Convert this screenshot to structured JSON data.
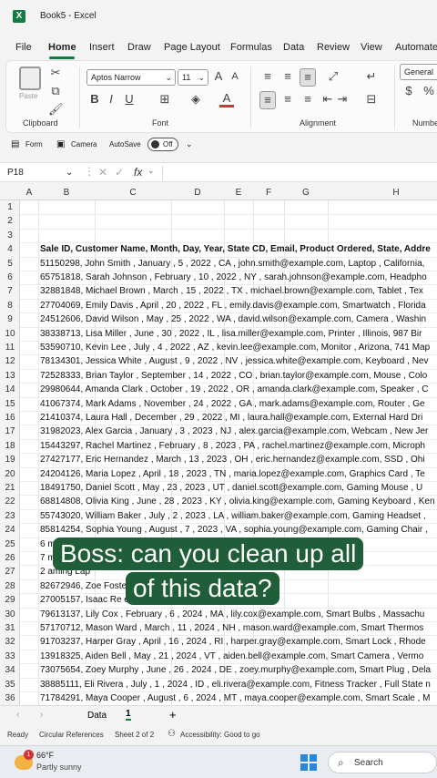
{
  "titlebar": {
    "app_icon": "X",
    "title": "Book5 - Excel"
  },
  "menu_tabs": [
    "File",
    "Home",
    "Insert",
    "Draw",
    "Page Layout",
    "Formulas",
    "Data",
    "Review",
    "View",
    "Automate"
  ],
  "ribbon": {
    "clipboard": {
      "paste_label": "Paste",
      "group_label": "Clipboard"
    },
    "font": {
      "font_name": "Aptos Narrow",
      "font_size": "11",
      "group_label": "Font"
    },
    "alignment": {
      "group_label": "Alignment"
    },
    "number": {
      "format": "General",
      "group_label": "Numbe"
    }
  },
  "quickbar": {
    "form_label": "Form",
    "camera_label": "Camera",
    "autosave_label": "AutoSave",
    "autosave_state": "Off"
  },
  "formula_bar": {
    "name_box": "P18",
    "fx": "fx"
  },
  "columns": [
    "A",
    "B",
    "C",
    "D",
    "E",
    "F",
    "G",
    "H"
  ],
  "rows": [
    {
      "n": "1",
      "text": ""
    },
    {
      "n": "2",
      "text": ""
    },
    {
      "n": "3",
      "text": ""
    },
    {
      "n": "4",
      "text": "Sale ID, Customer Name, Month, Day, Year, State CD, Email, Product Ordered, State, Addre",
      "bold": true
    },
    {
      "n": "5",
      "text": "51150298, John Smith , January , 5 , 2022 , CA , john.smith@example.com, Laptop , California,"
    },
    {
      "n": "6",
      "text": "65751818, Sarah Johnson , February , 10 , 2022 , NY , sarah.johnson@example.com, Headpho"
    },
    {
      "n": "7",
      "text": "32881848, Michael Brown , March , 15 , 2022 , TX , michael.brown@example.com, Tablet , Tex"
    },
    {
      "n": "8",
      "text": "27704069, Emily Davis , April , 20 , 2022 , FL , emily.davis@example.com, Smartwatch , Florida"
    },
    {
      "n": "9",
      "text": "24512606, David Wilson , May , 25 , 2022 , WA , david.wilson@example.com, Camera , Washin"
    },
    {
      "n": "10",
      "text": "38338713, Lisa Miller , June , 30 , 2022 , IL , lisa.miller@example.com, Printer , Illinois, 987 Bir"
    },
    {
      "n": "11",
      "text": "53590710, Kevin Lee , July , 4 , 2022 , AZ , kevin.lee@example.com, Monitor , Arizona, 741 Map"
    },
    {
      "n": "12",
      "text": "78134301, Jessica White , August , 9 , 2022 , NV , jessica.white@example.com, Keyboard , Nev"
    },
    {
      "n": "13",
      "text": "72528333, Brian Taylor , September , 14 , 2022 , CO , brian.taylor@example.com, Mouse , Colo"
    },
    {
      "n": "14",
      "text": "29980644, Amanda Clark , October , 19 , 2022 , OR , amanda.clark@example.com, Speaker , C"
    },
    {
      "n": "15",
      "text": "41067374, Mark Adams , November , 24 , 2022 , GA , mark.adams@example.com, Router , Ge"
    },
    {
      "n": "16",
      "text": "21410374, Laura Hall , December , 29 , 2022 , MI , laura.hall@example.com, External Hard Dri"
    },
    {
      "n": "17",
      "text": "31982023, Alex Garcia , January , 3 , 2023 , NJ , alex.garcia@example.com, Webcam , New Jer"
    },
    {
      "n": "18",
      "text": "15443297, Rachel Martinez , February , 8 , 2023 , PA , rachel.martinez@example.com, Microph"
    },
    {
      "n": "19",
      "text": "27427177, Eric Hernandez , March , 13 , 2023 , OH , eric.hernandez@example.com, SSD , Ohi"
    },
    {
      "n": "20",
      "text": "24204126, Maria Lopez , April , 18 , 2023 , TN , maria.lopez@example.com, Graphics Card , Te"
    },
    {
      "n": "21",
      "text": "18491750, Daniel Scott , May , 23 , 2023 , UT , daniel.scott@example.com, Gaming Mouse , U"
    },
    {
      "n": "22",
      "text": "68814808, Olivia King , June , 28 , 2023 , KY , olivia.king@example.com, Gaming Keyboard , Ken"
    },
    {
      "n": "23",
      "text": "55743020, William Baker , July , 2 , 2023 , LA , william.baker@example.com, Gaming Headset ,"
    },
    {
      "n": "24",
      "text": "85814254, Sophia Young , August , 7 , 2023 , VA , sophia.young@example.com, Gaming Chair ,"
    },
    {
      "n": "25",
      "text": "6                                                                                                         ming Desk"
    },
    {
      "n": "26",
      "text": "7                                                                                                         ming Mon"
    },
    {
      "n": "27",
      "text": "2                                                                                                         aming Lap"
    },
    {
      "n": "28",
      "text": "82672946, Zoe Foste                                                    xample.com, Gaming Console"
    },
    {
      "n": "29",
      "text": "27005157, Isaac Re                                                     example.com, Smart Home Hub ,"
    },
    {
      "n": "30",
      "text": "79613137, Lily Cox , February , 6 , 2024 , MA , lily.cox@example.com, Smart Bulbs , Massachu"
    },
    {
      "n": "31",
      "text": "57170712, Mason Ward , March , 11 , 2024 , NH , mason.ward@example.com, Smart Thermos"
    },
    {
      "n": "32",
      "text": "91703237, Harper Gray , April , 16 , 2024 , RI , harper.gray@example.com, Smart Lock , Rhode"
    },
    {
      "n": "33",
      "text": "13918325, Aiden Bell , May , 21 , 2024 , VT , aiden.bell@example.com, Smart Camera , Vermo"
    },
    {
      "n": "34",
      "text": "73075654, Zoey Murphy , June , 26 , 2024 , DE , zoey.murphy@example.com, Smart Plug , Dela"
    },
    {
      "n": "35",
      "text": "38885111, Eli Rivera , July , 1 , 2024 , ID , eli.rivera@example.com, Fitness Tracker , Full State n"
    },
    {
      "n": "36",
      "text": "71784291, Maya Cooper , August , 6 , 2024 , MT , maya.cooper@example.com, Smart Scale , M"
    }
  ],
  "sheet_tabs": {
    "tab1": "Data",
    "tab2": "1",
    "add": "+"
  },
  "statusbar": {
    "ready": "Ready",
    "circular": "Circular References",
    "sheet": "Sheet 2 of 2",
    "accessibility": "Accessibility: Good to go"
  },
  "taskbar": {
    "temp": "66°F",
    "weather": "Partly sunny",
    "badge": "1",
    "search": "Search"
  },
  "overlay": {
    "line1": "Boss: can you clean up all",
    "line2": "of this data?"
  }
}
